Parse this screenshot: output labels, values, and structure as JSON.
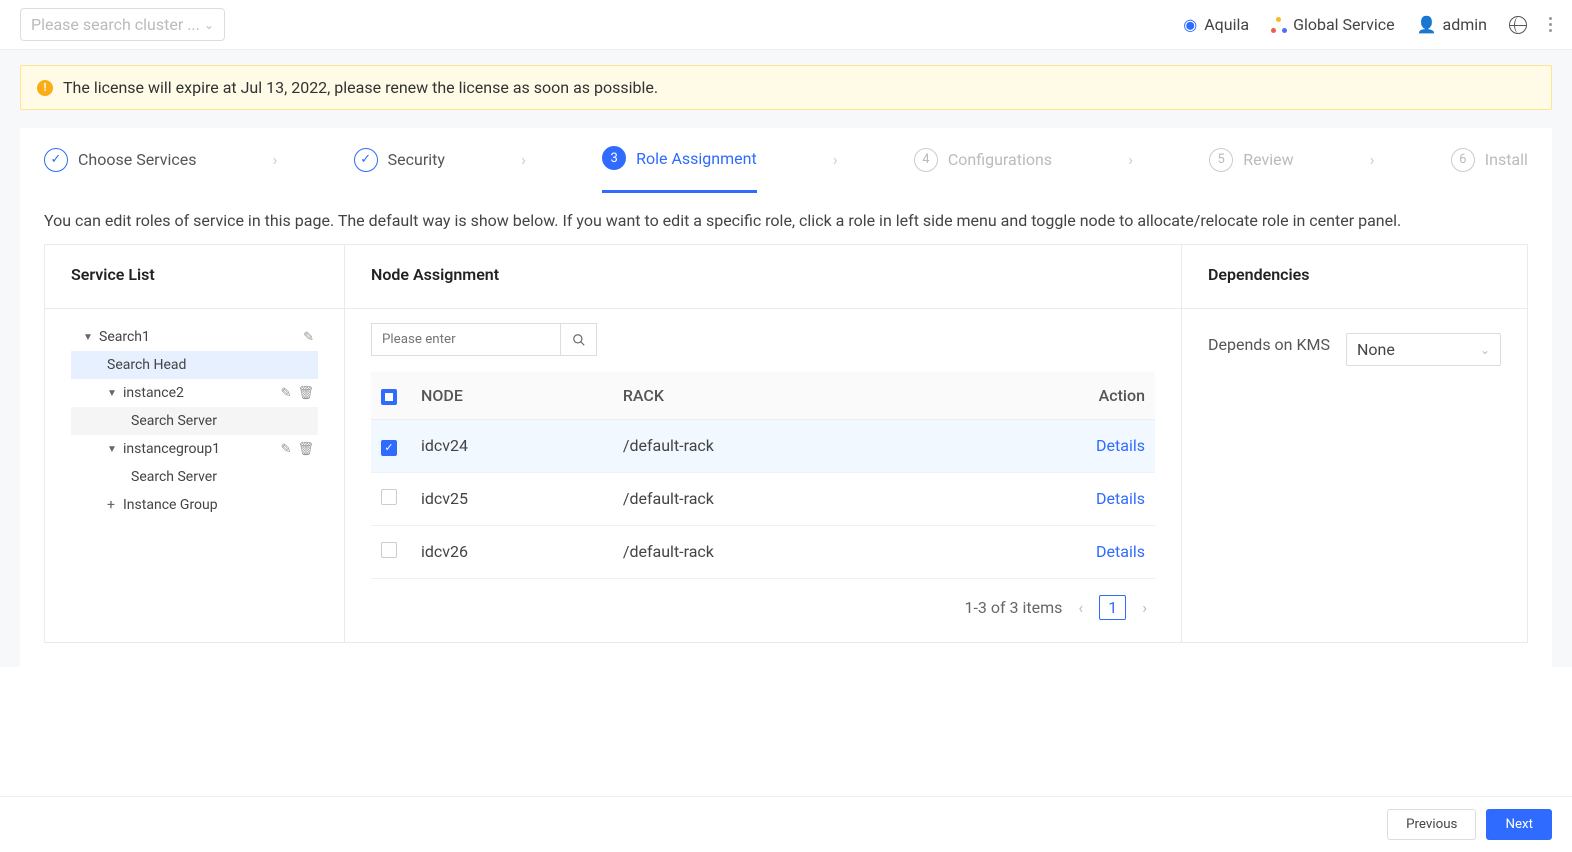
{
  "topbar": {
    "cluster_placeholder": "Please search cluster ...",
    "links": {
      "aquila": "Aquila",
      "global_service": "Global Service",
      "admin": "admin"
    }
  },
  "alert": {
    "text": "The license will expire at Jul 13, 2022, please renew the license as soon as possible."
  },
  "steps": {
    "s1": "Choose Services",
    "s2": "Security",
    "s3_num": "3",
    "s3": "Role Assignment",
    "s4_num": "4",
    "s4": "Configurations",
    "s5_num": "5",
    "s5": "Review",
    "s6_num": "6",
    "s6": "Install"
  },
  "content": {
    "intro": "You can edit roles of service in this page. The default way is show below. If you want to edit a specific role, click a role in left side menu and toggle node to allocate/relocate role in center panel.",
    "service_list_title": "Service List",
    "node_assignment_title": "Node Assignment",
    "dependencies_title": "Dependencies"
  },
  "tree": {
    "search1": "Search1",
    "search_head": "Search Head",
    "instance2": "instance2",
    "search_server1": "Search Server",
    "instancegroup1": "instancegroup1",
    "search_server2": "Search Server",
    "instance_group": "Instance Group"
  },
  "node_search_placeholder": "Please enter",
  "table": {
    "hdr_node": "NODE",
    "hdr_rack": "RACK",
    "hdr_action": "Action",
    "rows": [
      {
        "node": "idcv24",
        "rack": "/default-rack",
        "action": "Details",
        "checked": true
      },
      {
        "node": "idcv25",
        "rack": "/default-rack",
        "action": "Details",
        "checked": false
      },
      {
        "node": "idcv26",
        "rack": "/default-rack",
        "action": "Details",
        "checked": false
      }
    ],
    "paging_text": "1-3 of 3 items",
    "page_num": "1"
  },
  "dependencies": {
    "label": "Depends on KMS",
    "value": "None"
  },
  "footer": {
    "previous": "Previous",
    "next": "Next"
  }
}
